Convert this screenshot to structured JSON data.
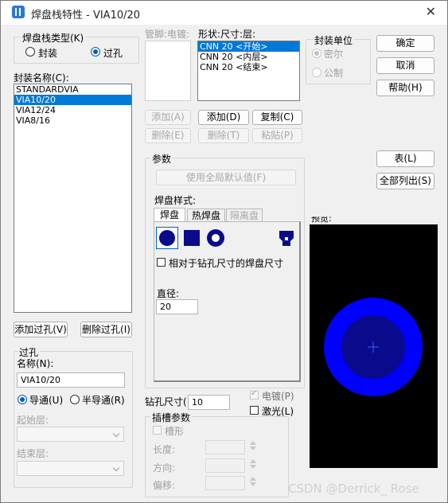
{
  "window": {
    "title": "焊盘栈特性 - VIA10/20",
    "close_symbol": "✕"
  },
  "padstack_type": {
    "label": "焊盘栈类型(K)",
    "options": [
      "封装",
      "过孔"
    ],
    "selected": "过孔"
  },
  "package_name": {
    "label": "封装名称(C):",
    "items": [
      "STANDARDVIA",
      "VIA10/20",
      "VIA12/24",
      "VIA8/16"
    ],
    "selected": "VIA10/20"
  },
  "left_buttons": {
    "add_via": "添加过孔(V)",
    "delete_via": "删除过孔(I)"
  },
  "via_group": {
    "title": "过孔",
    "name_label": "名称(N):",
    "name_value": "VIA10/20",
    "radio_options": [
      "导通(U)",
      "半导通(R)"
    ],
    "selected": "导通(U)",
    "start_layer_label": "起始层:",
    "end_layer_label": "结束层:"
  },
  "pin_columns": {
    "pin_label": "管脚:电镀:",
    "shape_label": "形状:尺寸:层:"
  },
  "layer_list": [
    "CNN 20 <开始>",
    "CNN 20 <内层>",
    "CNN 20 <结束>"
  ],
  "layer_selected": "CNN 20 <开始>",
  "pin_buttons": {
    "add_left": "添加(A)",
    "delete_left": "删除(E)",
    "add": "添加(D)",
    "copy": "复制(C)",
    "delete": "删除(T)",
    "paste": "粘贴(P)"
  },
  "units": {
    "title": "封装单位",
    "options": [
      "密尔",
      "公制"
    ],
    "selected": "密尔"
  },
  "right_buttons": {
    "ok": "确定",
    "cancel": "取消",
    "help": "帮助(H)",
    "table": "表(L)",
    "list_all": "全部列出(S)"
  },
  "params": {
    "title": "参数",
    "use_global": "使用全局默认值(F)",
    "pad_style_label": "焊盘样式:",
    "tabs": [
      "焊盘",
      "热焊盘",
      "隔离盘"
    ],
    "active_tab": "焊盘",
    "shape_icons": [
      "circle-shape-icon",
      "square-shape-icon",
      "annulus-shape-icon",
      "custom-shape-icon"
    ],
    "relative_check": "相对于钻孔尺寸的焊盘尺寸",
    "diameter_label": "直径:",
    "diameter_value": "20"
  },
  "drill": {
    "label": "钻孔尺寸(",
    "value": "10",
    "plated_label": "电镀(P)",
    "plated_checked": true,
    "laser_label": "激光(L)",
    "laser_checked": false
  },
  "slot": {
    "title": "插槽参数",
    "slot_label": "槽形",
    "length_label": "长度:",
    "direction_label": "方向:",
    "offset_label": "偏移:"
  },
  "preview": {
    "label": "预览:",
    "background": "#000000",
    "outer_color": "#0000ff",
    "inner_color": "#0a0a8c"
  },
  "watermark": "CSDN @Derrick_ Rose"
}
